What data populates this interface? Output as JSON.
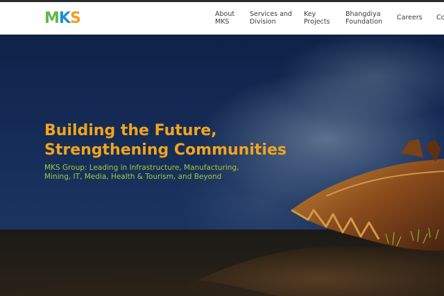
{
  "brand": {
    "logo_text": "MKS",
    "colors": {
      "m": "#5fb84a",
      "k": "#1f8fd0",
      "s": "#f39c1f"
    }
  },
  "nav": {
    "items": [
      {
        "line1": "About",
        "line2": "MKS"
      },
      {
        "line1": "Services and",
        "line2": "Division"
      },
      {
        "line1": "Key",
        "line2": "Projects"
      },
      {
        "line1": "Bhangdiya",
        "line2": "Foundation"
      },
      {
        "line1": "Careers",
        "line2": ""
      },
      {
        "line1": "Co",
        "line2": ""
      }
    ]
  },
  "hero": {
    "headline_line1": "Building the Future,",
    "headline_line2": "Strengthening Communities",
    "subline_line1": "MKS Group: Leading in Infrastructure, Manufacturing,",
    "subline_line2": "Mining, IT, Media, Health & Tourism, and Beyond",
    "headline_color": "#f2a41d",
    "subline_color": "#a3c93a"
  }
}
